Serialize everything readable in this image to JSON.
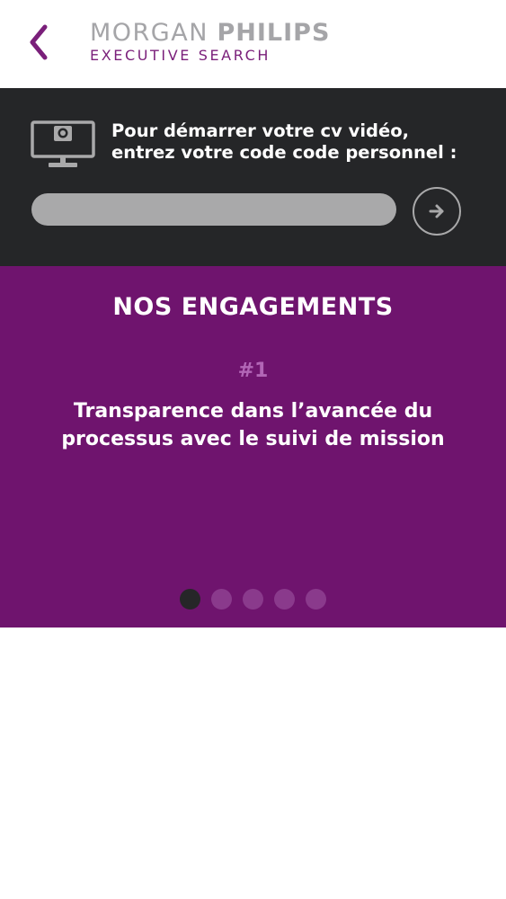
{
  "header": {
    "logo_primary": "MORGAN",
    "logo_bold": "PHILIPS",
    "logo_secondary": "EXECUTIVE SEARCH",
    "back_icon": "chevron-left-icon",
    "accent_color": "#7a1f7a"
  },
  "cv_video": {
    "instruction_line1": "Pour démarrer votre cv vidéo,",
    "instruction_line2": "entrez votre code code personnel :",
    "code_value": "",
    "code_placeholder": "",
    "monitor_icon": "webcam-monitor-icon",
    "submit_icon": "arrow-right-icon",
    "background_color": "#252628"
  },
  "engagements": {
    "title": "NOS ENGAGEMENTS",
    "current_number": "#1",
    "current_text": "Transparence dans l’avancée du processus avec le suivi de mission",
    "background_color": "#6f146e",
    "slide_count": 5,
    "active_slide": 1
  }
}
